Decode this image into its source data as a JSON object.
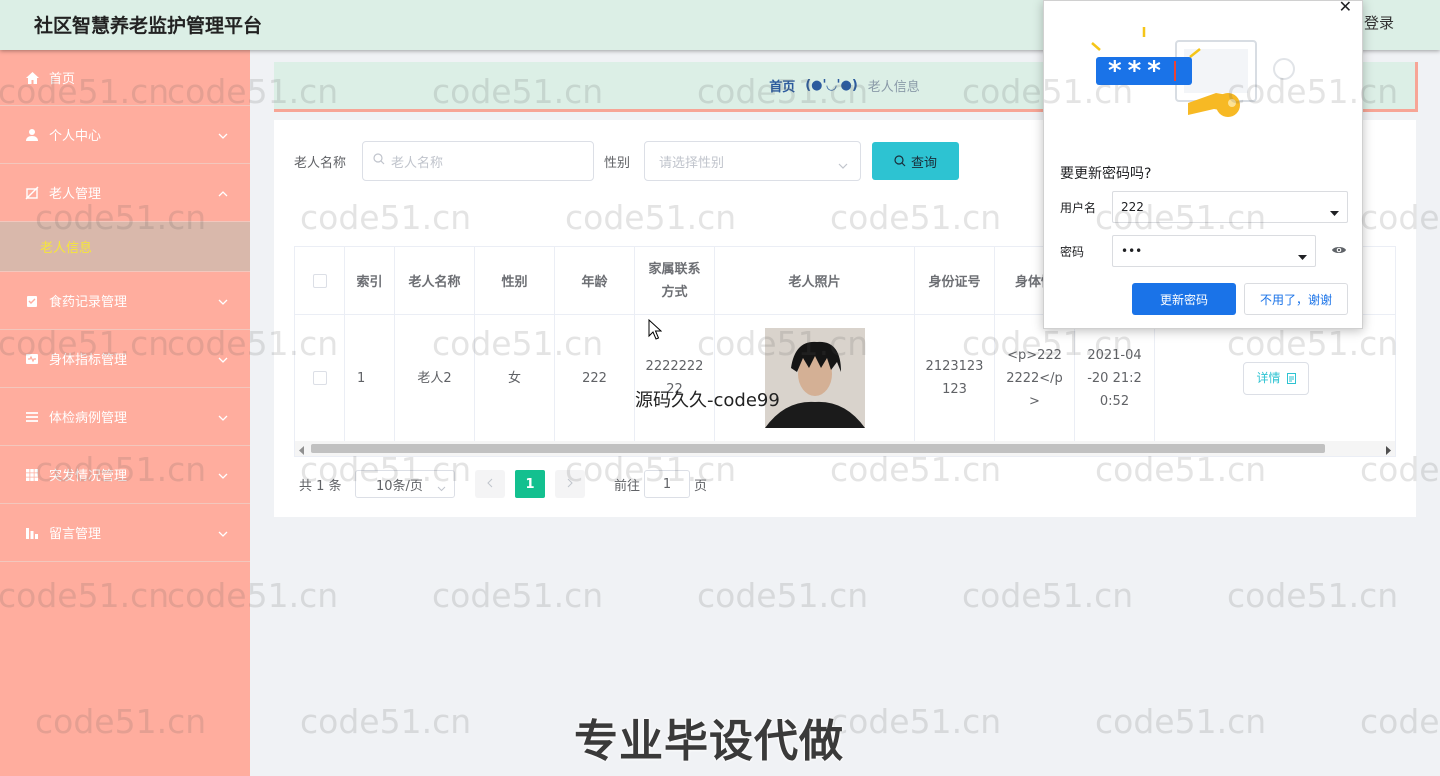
{
  "header": {
    "title": "社区智慧养老监护管理平台",
    "login": "登录"
  },
  "sidebar": {
    "items": [
      {
        "label": "首页",
        "icon": "home-icon"
      },
      {
        "label": "个人中心",
        "icon": "user-icon"
      },
      {
        "label": "老人管理",
        "icon": "elder-icon"
      },
      {
        "sub_label": "老人信息"
      },
      {
        "label": "食药记录管理",
        "icon": "clipboard-icon"
      },
      {
        "label": "身体指标管理",
        "icon": "body-metrics-icon"
      },
      {
        "label": "体检病例管理",
        "icon": "list-icon"
      },
      {
        "label": "突发情况管理",
        "icon": "grid-icon"
      },
      {
        "label": "留言管理",
        "icon": "chart-icon"
      }
    ]
  },
  "breadcrumb": {
    "home": "首页",
    "face": "(●'◡'●)",
    "current": "老人信息"
  },
  "search": {
    "name_label": "老人名称",
    "name_placeholder": "老人名称",
    "gender_label": "性别",
    "gender_placeholder": "请选择性别",
    "query_button": "查询"
  },
  "table": {
    "headers": [
      "索引",
      "老人名称",
      "性别",
      "年龄",
      "家属联系方式",
      "老人照片",
      "身份证号",
      "身体情"
    ],
    "row": {
      "index": "1",
      "name": "老人2",
      "gender": "女",
      "age": "222",
      "contact": "2222222 22",
      "id_no": "2123123 123",
      "body": "<p>222 2222</p >",
      "date": "2021-04 -20 21:2 0:52",
      "detail": "详情"
    }
  },
  "pagination": {
    "total": "共 1 条",
    "page_size": "10条/页",
    "current_page": "1",
    "goto_label": "前往",
    "goto_value": "1",
    "page_unit": "页"
  },
  "password_popup": {
    "question": "要更新密码吗?",
    "username_label": "用户名",
    "username_value": "222",
    "password_label": "密码",
    "password_value": "•••",
    "update_button": "更新密码",
    "decline_button": "不用了，谢谢",
    "mask_chars": "***"
  },
  "watermark": {
    "text": "code51.cn",
    "overlay_big": "专业毕设代做",
    "overlay_small": "源码久久-code99"
  },
  "colors": {
    "sidebar": "#ffad9e",
    "header": "#dcefe6",
    "accent": "#2dc3d2",
    "page_active": "#13c08f",
    "chrome_blue": "#1a73e8"
  }
}
